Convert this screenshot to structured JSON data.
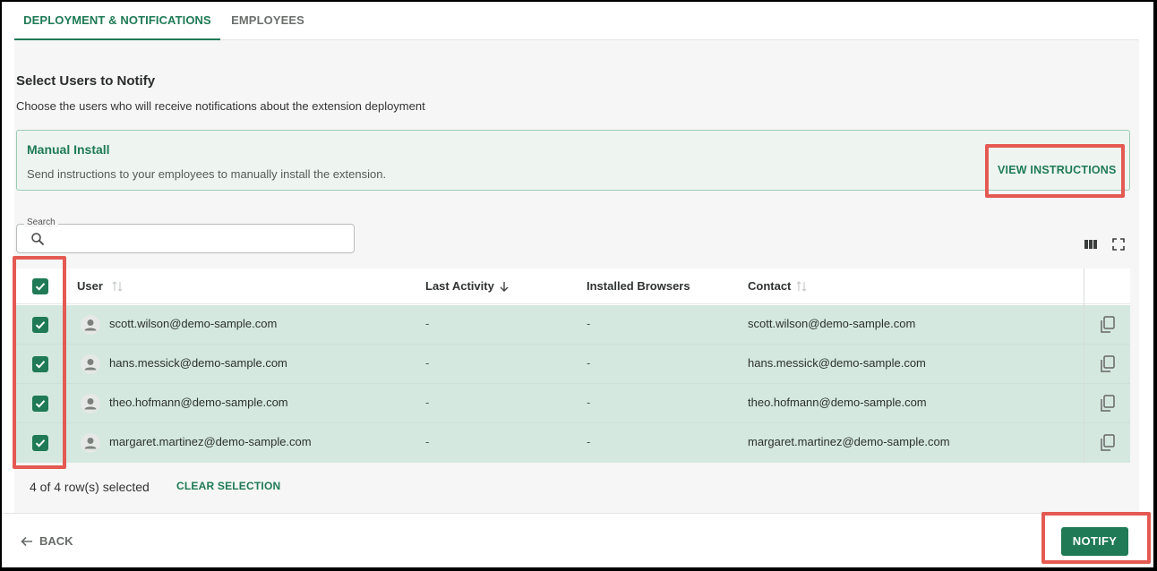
{
  "tabs": [
    {
      "label": "DEPLOYMENT & NOTIFICATIONS",
      "active": true
    },
    {
      "label": "EMPLOYEES",
      "active": false
    }
  ],
  "section": {
    "title": "Select Users to Notify",
    "description": "Choose the users who will receive notifications about the extension deployment"
  },
  "manual_install": {
    "title": "Manual Install",
    "description": "Send instructions to your employees to manually install the extension.",
    "action_label": "VIEW INSTRUCTIONS"
  },
  "search": {
    "label": "Search",
    "placeholder": "",
    "value": ""
  },
  "table": {
    "columns": [
      "User",
      "Last Activity",
      "Installed Browsers",
      "Contact"
    ],
    "rows": [
      {
        "user": "scott.wilson@demo-sample.com",
        "last_activity": "-",
        "browsers": "-",
        "contact": "scott.wilson@demo-sample.com",
        "checked": true
      },
      {
        "user": "hans.messick@demo-sample.com",
        "last_activity": "-",
        "browsers": "-",
        "contact": "hans.messick@demo-sample.com",
        "checked": true
      },
      {
        "user": "theo.hofmann@demo-sample.com",
        "last_activity": "-",
        "browsers": "-",
        "contact": "theo.hofmann@demo-sample.com",
        "checked": true
      },
      {
        "user": "margaret.martinez@demo-sample.com",
        "last_activity": "-",
        "browsers": "-",
        "contact": "margaret.martinez@demo-sample.com",
        "checked": true
      }
    ]
  },
  "selection": {
    "status": "4 of 4 row(s) selected",
    "clear_label": "CLEAR SELECTION"
  },
  "footer": {
    "back_label": "BACK",
    "notify_label": "NOTIFY"
  },
  "colors": {
    "accent": "#1f7a55",
    "highlight": "#e45a52",
    "selected_row": "#d4e8e0"
  }
}
